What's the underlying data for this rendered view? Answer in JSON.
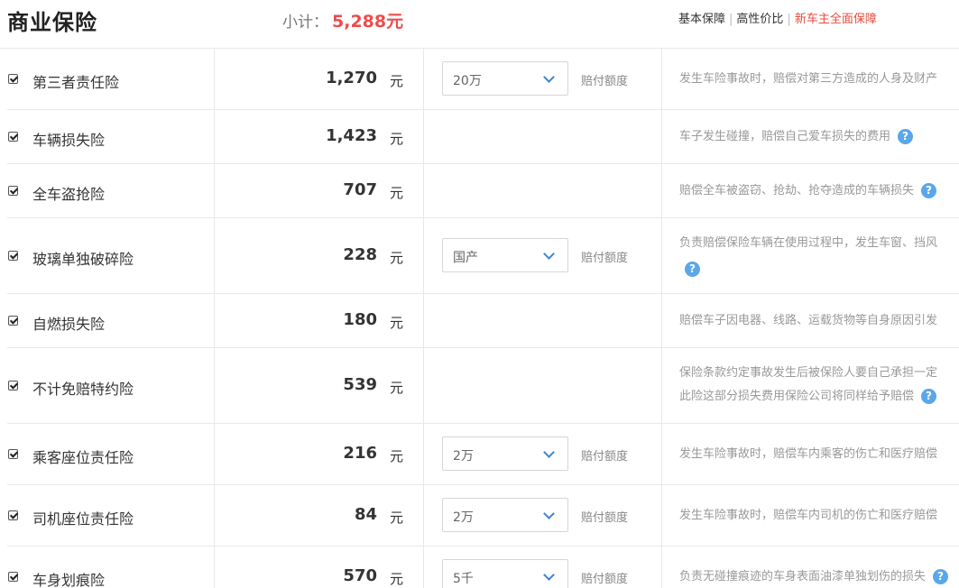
{
  "header": {
    "title": "商业保险",
    "subtotal_label": "小计：",
    "subtotal_value": "5,288元",
    "plans": [
      {
        "label": "基本保障",
        "active": false
      },
      {
        "label": "高性价比",
        "active": false
      },
      {
        "label": "新车主全面保障",
        "active": true
      }
    ]
  },
  "icons": {
    "checkbox": "checkbox-checked-icon",
    "dropdown": "chevron-down-icon",
    "help": "question-circle-icon"
  },
  "colors": {
    "accent_red": "#f04b4b",
    "help_blue": "#5aa7ea",
    "chevron_blue": "#3b84d6"
  },
  "unit": "元",
  "limit_label": "赔付额度",
  "rows": [
    {
      "name": "第三者责任险",
      "price": "1,270",
      "select": "20万",
      "desc": "发生车险事故时，赔偿对第三方造成的人身及财产",
      "desc2": ""
    },
    {
      "name": "车辆损失险",
      "price": "1,423",
      "select": "",
      "desc": "车子发生碰撞，赔偿自己爱车损失的费用",
      "desc2": ""
    },
    {
      "name": "全车盗抢险",
      "price": "707",
      "select": "",
      "desc": "赔偿全车被盗窃、抢劫、抢夺造成的车辆损失",
      "desc2": ""
    },
    {
      "name": "玻璃单独破碎险",
      "price": "228",
      "select": "国产",
      "desc": "负责赔偿保险车辆在使用过程中，发生车窗、挡风",
      "desc2": ""
    },
    {
      "name": "自燃损失险",
      "price": "180",
      "select": "",
      "desc": "赔偿车子因电器、线路、运载货物等自身原因引发",
      "desc2": ""
    },
    {
      "name": "不计免赔特约险",
      "price": "539",
      "select": "",
      "desc": "保险条款约定事故发生后被保险人要自己承担一定",
      "desc2": "此险这部分损失费用保险公司将同样给予赔偿"
    },
    {
      "name": "乘客座位责任险",
      "price": "216",
      "select": "2万",
      "desc": "发生车险事故时，赔偿车内乘客的伤亡和医疗赔偿",
      "desc2": ""
    },
    {
      "name": "司机座位责任险",
      "price": "84",
      "select": "2万",
      "desc": "发生车险事故时，赔偿车内司机的伤亡和医疗赔偿",
      "desc2": ""
    },
    {
      "name": "车身划痕险",
      "price": "570",
      "select": "5千",
      "desc": "负责无碰撞痕迹的车身表面油漆单独划伤的损失",
      "desc2": ""
    }
  ]
}
